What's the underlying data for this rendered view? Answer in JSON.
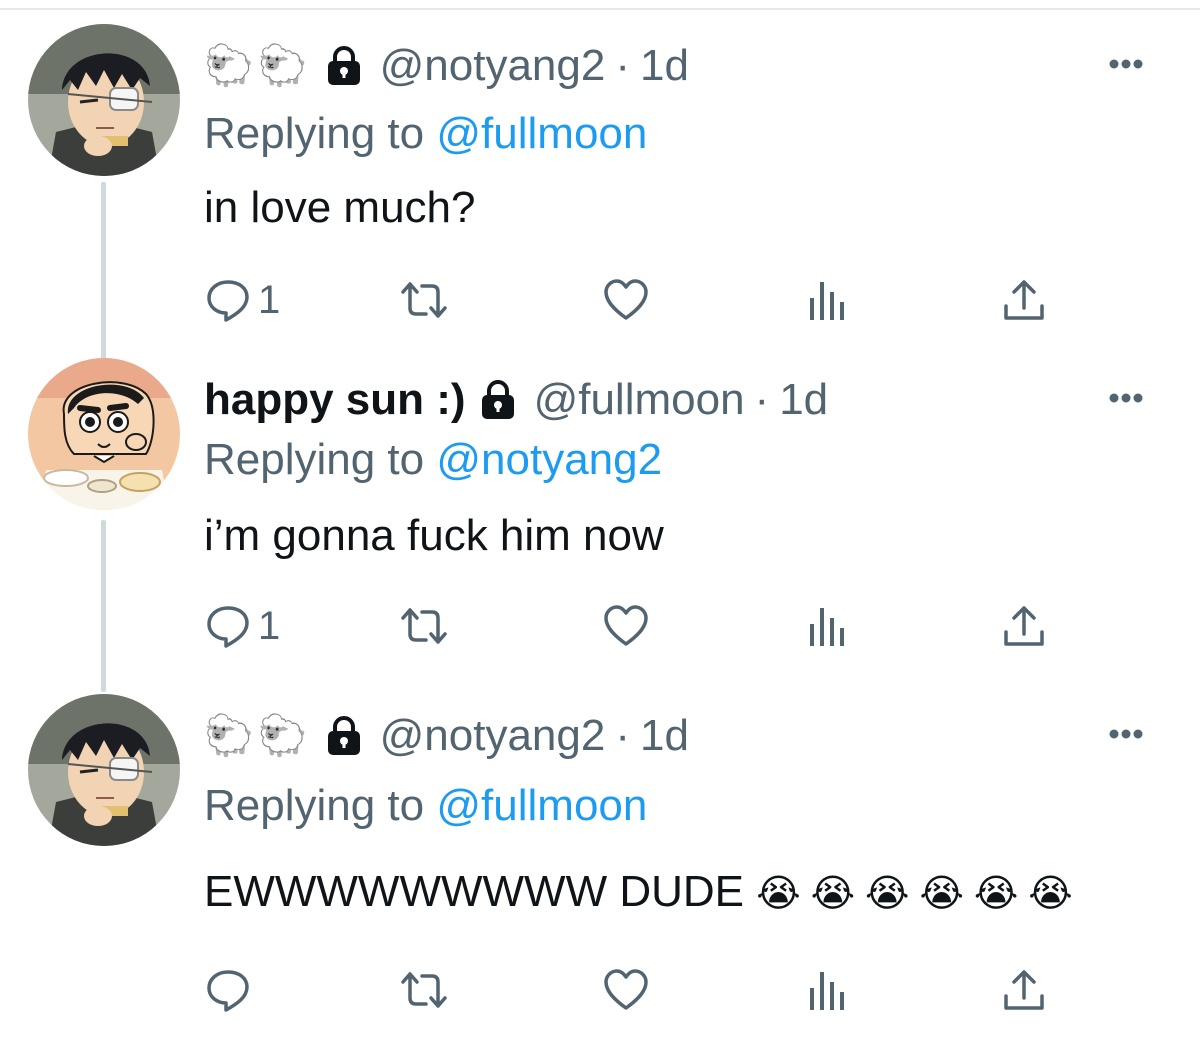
{
  "tweets": [
    {
      "display_name": "🐑🐑",
      "display_name_bold": false,
      "protected": true,
      "handle": "@notyang2",
      "separator": "·",
      "time": "1d",
      "replying_prefix": "Replying to",
      "replying_to": "@fullmoon",
      "text": "in love much?",
      "emojis": "",
      "reply_count": "1",
      "avatar": "anime-boy-eyepatch-avatar"
    },
    {
      "display_name": "happy sun :)",
      "display_name_bold": true,
      "protected": true,
      "handle": "@fullmoon",
      "separator": "·",
      "time": "1d",
      "replying_prefix": "Replying to",
      "replying_to": "@notyang2",
      "text": "i’m gonna fuck him now",
      "emojis": "",
      "reply_count": "1",
      "avatar": "cartoon-boy-eating-avatar"
    },
    {
      "display_name": "🐑🐑",
      "display_name_bold": false,
      "protected": true,
      "handle": "@notyang2",
      "separator": "·",
      "time": "1d",
      "replying_prefix": "Replying to",
      "replying_to": "@fullmoon",
      "text": "EWWWWWWWWW DUDE",
      "emojis": "😭😭😭😭😭😭",
      "reply_count": "",
      "avatar": "anime-boy-eyepatch-avatar"
    }
  ],
  "icons": {
    "reply": "reply-icon",
    "retweet": "retweet-icon",
    "like": "like-icon",
    "views": "views-icon",
    "share": "share-icon",
    "more": "more-icon",
    "lock": "lock-icon"
  },
  "colors": {
    "link": "#1d9bf0",
    "secondary_text": "#536471",
    "primary_text": "#0f1419",
    "thread_line": "#cfd9de"
  }
}
